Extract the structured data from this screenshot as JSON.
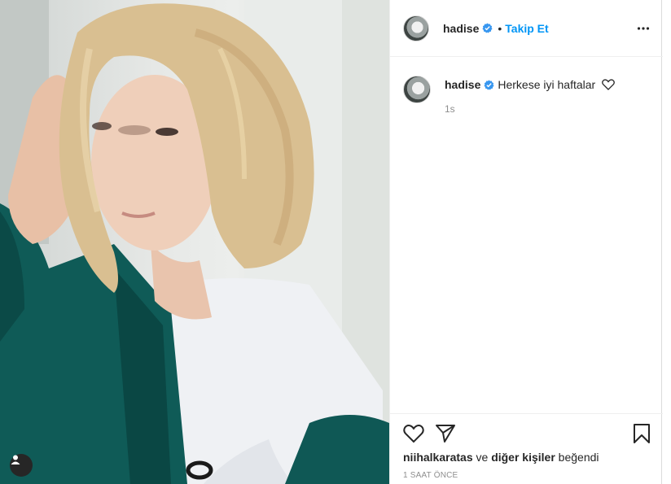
{
  "post": {
    "username": "hadise",
    "separator": "•",
    "follow_label": "Takip Et",
    "caption": "Herkese iyi haftalar",
    "caption_time": "1s",
    "liked_by_user": "niihalkaratas",
    "liked_by_joiner": "ve",
    "liked_by_others": "diğer kişiler",
    "liked_by_suffix": "beğendi",
    "post_time": "1 SAAT ÖNCE"
  },
  "colors": {
    "accent": "#0095f6",
    "text": "#262626",
    "muted": "#8e8e8e",
    "verified": "#3897f0"
  },
  "icons": {
    "more": "more-options-icon",
    "like": "heart-icon",
    "share": "paper-plane-icon",
    "save": "bookmark-icon",
    "tag": "user-tag-icon",
    "verified": "verified-badge-icon"
  }
}
